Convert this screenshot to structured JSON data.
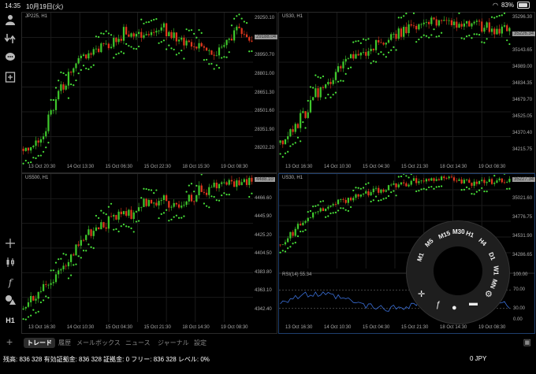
{
  "status": {
    "time": "14:35",
    "date": "10月19日(火)",
    "battery": "83%"
  },
  "toolbar_icons": [
    "account-icon",
    "trade-arrows-icon",
    "chat-icon",
    "new-order-icon",
    "crosshair-icon",
    "chart-type-icon",
    "indicators-icon",
    "objects-icon",
    "timeframe-h1-label"
  ],
  "timeframe_label": "H1",
  "charts": [
    {
      "symbol": "JP225, H1",
      "prices": [
        "29250.10",
        "29188.04",
        "28950.70",
        "28801.00",
        "28651.30",
        "28501.60",
        "28351.90",
        "28202.20"
      ],
      "current": "29188.04",
      "times": [
        "13 Oct 20:30",
        "14 Oct 13:30",
        "15 Oct 06:30",
        "15 Oct 22:30",
        "18 Oct 15:30",
        "19 Oct 08:30"
      ]
    },
    {
      "symbol": "US30, H1",
      "prices": [
        "35296.30",
        "35226.34",
        "35143.65",
        "34989.00",
        "34834.35",
        "34679.70",
        "34525.05",
        "34370.40",
        "34215.75"
      ],
      "current": "35226.34",
      "times": [
        "13 Oct 16:30",
        "14 Oct 10:30",
        "15 Oct 04:30",
        "15 Oct 21:30",
        "18 Oct 14:30",
        "19 Oct 08:30"
      ]
    },
    {
      "symbol": "US500, H1",
      "prices": [
        "4488.10",
        "4466.60",
        "4445.90",
        "4425.20",
        "4404.50",
        "4383.80",
        "4363.10",
        "4342.40"
      ],
      "current": "4488.10",
      "times": [
        "13 Oct 16:30",
        "14 Oct 10:30",
        "15 Oct 04:30",
        "15 Oct 21:30",
        "18 Oct 14:30",
        "19 Oct 08:30"
      ]
    },
    {
      "symbol": "US30, H1",
      "prices": [
        "35227.34",
        "35021.60",
        "34776.75",
        "34531.90",
        "34286.65"
      ],
      "current": "35227.34",
      "rsi_label": "RSI(14) 55.34",
      "rsi_levels": [
        "100.00",
        "70.00",
        "30.00",
        "0.00"
      ],
      "times": [
        "13 Oct 16:30",
        "14 Oct 10:30",
        "15 Oct 04:30",
        "15 Oct 21:30",
        "18 Oct 14:30",
        "19 Oct 08:30"
      ]
    }
  ],
  "wheel": {
    "timeframes": [
      "M1",
      "M5",
      "M15",
      "M30",
      "H1",
      "H4",
      "D1",
      "W1",
      "MN"
    ],
    "icons": [
      "crosshair-icon",
      "indicators-icon",
      "objects-icon",
      "chart-type-icon",
      "settings-icon"
    ]
  },
  "tabs": {
    "items": [
      "トレード",
      "履歴",
      "メールボックス",
      "ニュース",
      "ジャーナル",
      "設定"
    ],
    "selected": 0
  },
  "footer": {
    "account": "残高: 836 328 有効証拠金: 836 328 証拠金: 0 フリー: 836 328 レベル: 0%",
    "pnl": "0  JPY"
  },
  "colors": {
    "bull": "#3ec62b",
    "bear": "#e2371d",
    "sar": "#49e33a",
    "rsi": "#3a6fd8"
  }
}
